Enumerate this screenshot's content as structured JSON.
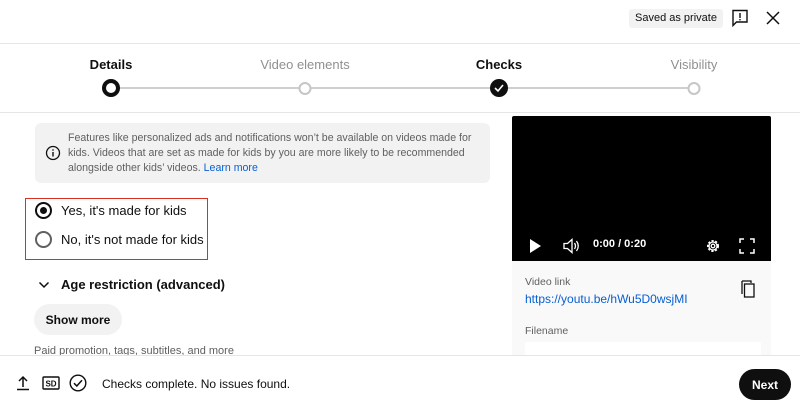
{
  "header": {
    "saved_badge": "Saved as private",
    "icons": [
      "feedback-icon",
      "close-icon"
    ]
  },
  "stepper": {
    "steps": [
      {
        "label": "Details",
        "state": "current"
      },
      {
        "label": "Video elements",
        "state": "upcoming"
      },
      {
        "label": "Checks",
        "state": "done"
      },
      {
        "label": "Visibility",
        "state": "upcoming"
      }
    ]
  },
  "audience": {
    "info_text": "Features like personalized ads and notifications won’t be available on videos made for kids. Videos that are set as made for kids by you are more likely to be recommended alongside other kids’ videos.",
    "info_link": "Learn more",
    "options": [
      {
        "label": "Yes, it's made for kids",
        "selected": true
      },
      {
        "label": "No, it's not made for kids",
        "selected": false
      }
    ],
    "highlight_color": "#d93025"
  },
  "age_restriction": {
    "label": "Age restriction (advanced)"
  },
  "show_more": {
    "label": "Show more"
  },
  "paid_text": "Paid promotion, tags, subtitles, and more",
  "preview": {
    "time": "0:00 / 0:20",
    "video_link_label": "Video link",
    "video_link": "https://youtu.be/hWu5D0wsjMI",
    "filename_label": "Filename"
  },
  "footer": {
    "status": "Checks complete. No issues found.",
    "next_label": "Next",
    "sd_badge": "SD"
  },
  "colors": {
    "link": "#065fd4",
    "primary": "#0f0f0f"
  }
}
